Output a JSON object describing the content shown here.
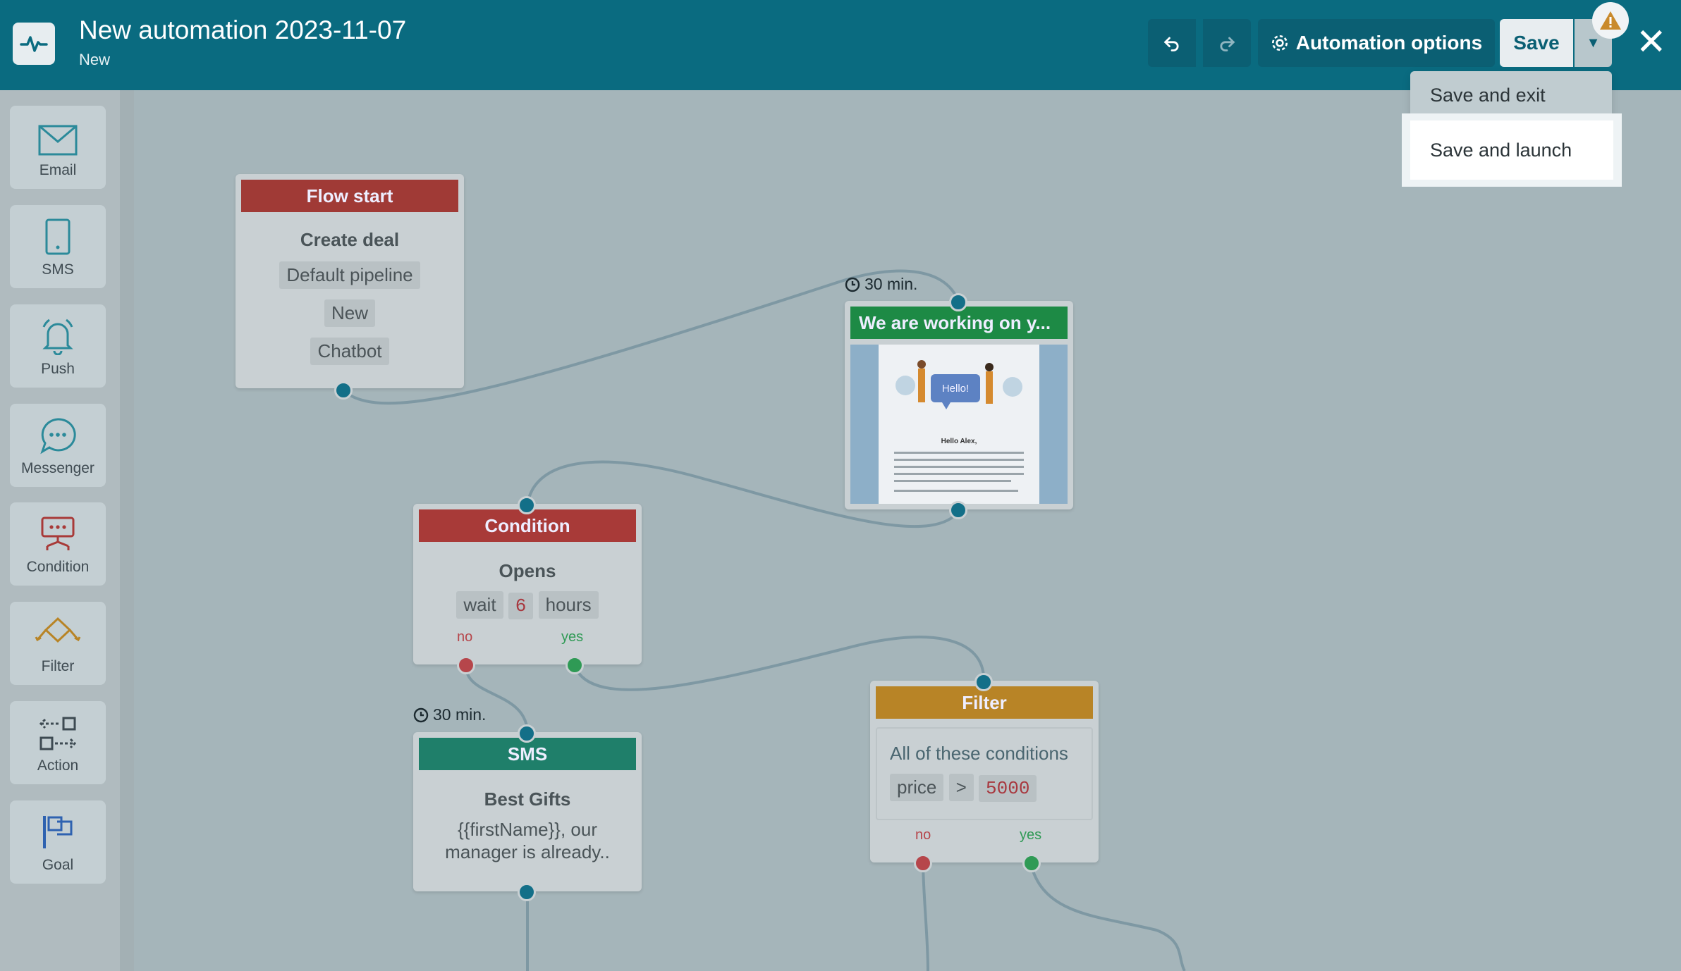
{
  "header": {
    "title": "New automation 2023-11-07",
    "status": "New",
    "options_label": "Automation options",
    "save_label": "Save"
  },
  "menu": {
    "items": [
      "Save and exit",
      "Save and launch"
    ]
  },
  "sidebar": {
    "items": [
      "Email",
      "SMS",
      "Push",
      "Messenger",
      "Condition",
      "Filter",
      "Action",
      "Goal"
    ]
  },
  "nodes": {
    "flow_start": {
      "title": "Flow start",
      "action": "Create deal",
      "chips": [
        "Default pipeline",
        "New",
        "Chatbot"
      ]
    },
    "email": {
      "title": "We are working on y...",
      "delay": "30 min.",
      "preview_greeting": "Hello Alex,",
      "preview_bubble": "Hello!"
    },
    "condition": {
      "title": "Condition",
      "event": "Opens",
      "wait": "wait",
      "wait_value": "6",
      "wait_unit": "hours",
      "no": "no",
      "yes": "yes"
    },
    "sms": {
      "title": "SMS",
      "delay": "30 min.",
      "name": "Best Gifts",
      "text": "{{firstName}}, our manager is already.."
    },
    "filter": {
      "title": "Filter",
      "rule": "All of these conditions",
      "field": "price",
      "op": ">",
      "value": "5000",
      "no": "no",
      "yes": "yes"
    }
  },
  "colors": {
    "header": "#0a6b80",
    "flow_start": "#a03a36",
    "email": "#1d8a45",
    "condition": "#a83a38",
    "sms": "#1f7f6a",
    "filter": "#b88426"
  }
}
